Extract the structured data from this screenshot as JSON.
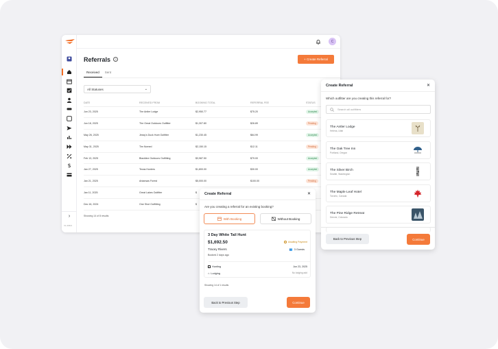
{
  "page": {
    "title": "Referrals",
    "create_label": "Create Referral",
    "avatar_initial": "C",
    "version": "V1.298.0"
  },
  "tabs": [
    "Received",
    "Sent"
  ],
  "filter": {
    "value": "All Statuses"
  },
  "table": {
    "headers": [
      "DATE",
      "RECEIVED FROM",
      "BOOKING TOTAL",
      "REFERRAL FEE",
      "STATUS"
    ],
    "rows": [
      [
        "Jun 23, 2025",
        "The Antler Lodge",
        "$2,950.77",
        "$75.20",
        "Accepted"
      ],
      [
        "Jun 18, 2025",
        "The Great Outdoors Outfitter",
        "$1,307.80",
        "$26.89",
        "Pending"
      ],
      [
        "May 26, 2025",
        "Jessy's Duck Hunt Outfitter",
        "$1,230.45",
        "$64.99",
        "Accepted"
      ],
      [
        "May 31, 2025",
        "Tim Nomed",
        "$2,150.15",
        "$12.11",
        "Pending"
      ],
      [
        "Feb 13, 2025",
        "Blackline Outdoors Outfitting",
        "$3,987.50",
        "$79.00",
        "Accepted"
      ],
      [
        "Jan 27, 2025",
        "Texas Hunters",
        "$1,800.00",
        "$30.00",
        "Accepted"
      ],
      [
        "Jan 21, 2025",
        "Arkansas Forest",
        "$5,000.00",
        "$100.00",
        "Pending"
      ],
      [
        "Jan 11, 2025",
        "Great Lakes Outfitter",
        "$",
        "",
        ""
      ],
      [
        "Dec 16, 2024",
        "One Shot Outfitting",
        "$",
        "",
        ""
      ]
    ],
    "showing": "Showing 14 of 8 results"
  },
  "outfitter_modal": {
    "title": "Create Referral",
    "question": "Which outfitter are you creating this referral for?",
    "search_placeholder": "Search all outfitters",
    "outfitters": [
      {
        "name": "The Antler Lodge",
        "location": "Helena, Utah"
      },
      {
        "name": "The Oak Tree Inn",
        "location": "Portland, Oregon"
      },
      {
        "name": "The Silver Birch",
        "location": "Seattle, Washington"
      },
      {
        "name": "The Maple Leaf Hotel",
        "location": "Toronto, Canada"
      },
      {
        "name": "The Pine Ridge Retreat",
        "location": "Denver, Colorado"
      }
    ],
    "back_label": "Back to Previous Step",
    "continue_label": "Continue"
  },
  "booking_modal": {
    "title": "Create Referral",
    "question": "Are you creating a referral for an existing booking?",
    "with_label": "With Booking",
    "without_label": "Without Booking",
    "booking": {
      "title": "3 Day White Tail Hunt",
      "price": "$1,692.50",
      "badge": "Awaiting Payment",
      "guest": "Tracey Rivers",
      "guests_count": "3 Guests",
      "booked": "Booked 2 days ago",
      "hunting_label": "Hunting",
      "hunting_date": "Jun 23, 2025",
      "lodging_label": "Lodging",
      "lodging_value": "No lodging add"
    },
    "showing": "Showing 14 of 1 results",
    "back_label": "Back to Previous Step",
    "continue_label": "Continue"
  },
  "colors": {
    "accent": "#f47a3a",
    "accepted": "#2f8a4f",
    "pending": "#d06a3a",
    "background": "#f1f1f4"
  }
}
